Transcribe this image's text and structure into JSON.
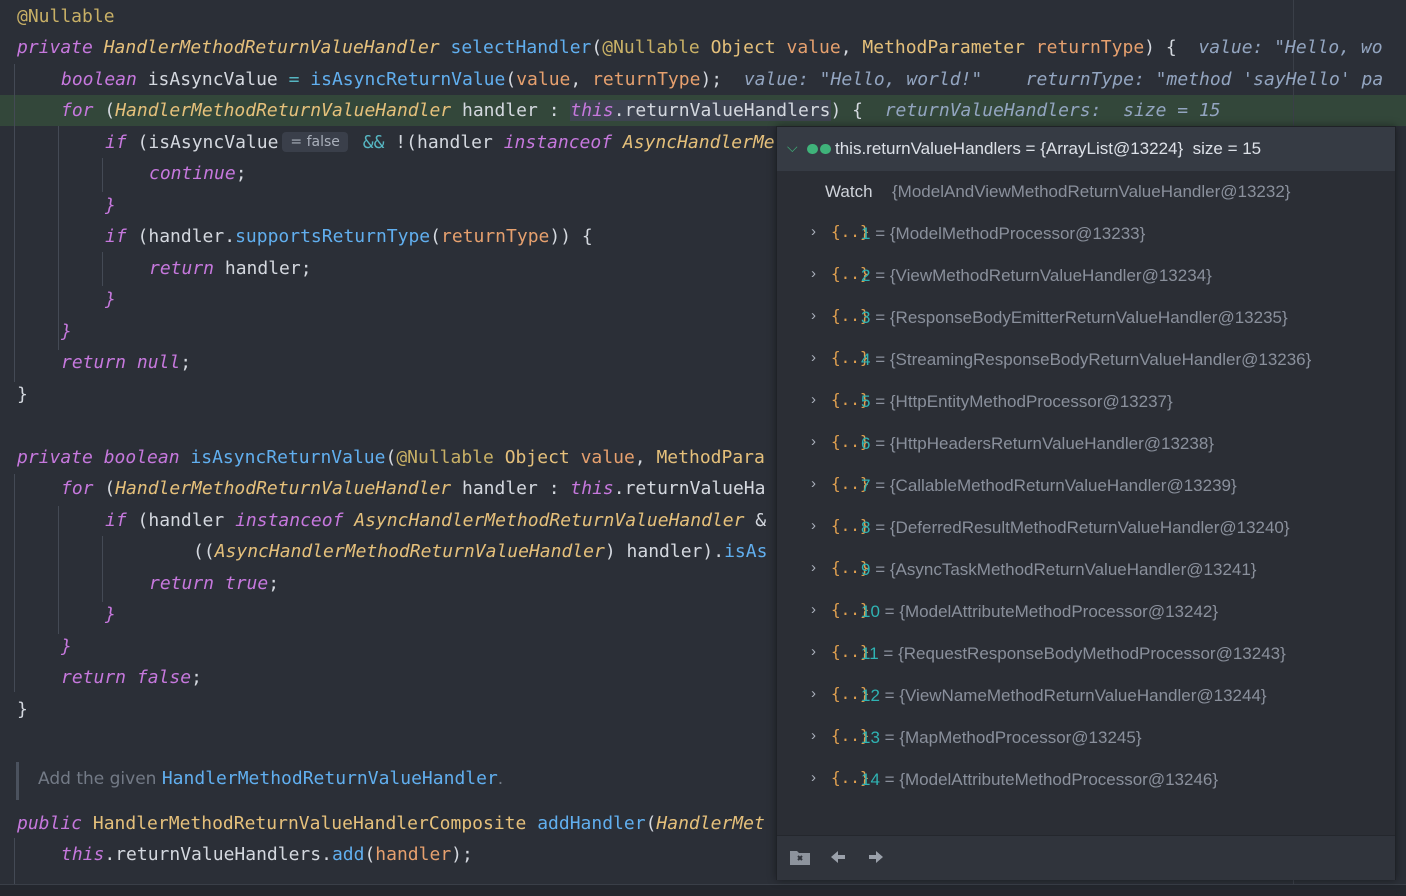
{
  "code": {
    "l1_annot": "@Nullable",
    "l2": {
      "kw": "private",
      "type": "HandlerMethodReturnValueHandler",
      "fn": "selectHandler",
      "p1": "(",
      "annot": "@Nullable",
      "t1": "Object",
      "v1": "value",
      "c": ",",
      "t2": "MethodParameter",
      "v2": "returnType",
      "tail": ") {",
      "hint": "value: \"Hello, wo"
    },
    "l3": {
      "kw": "boolean",
      "var": "isAsyncValue",
      "eq": "=",
      "fn": "isAsyncReturnValue",
      "args_open": "(",
      "a1": "value",
      "c": ",",
      "a2": "returnType",
      "close": ");",
      "hint1": "value: \"Hello, world!\"",
      "hint2": "returnType: \"method 'sayHello' pa"
    },
    "l4": {
      "kw": "for",
      "open": "(",
      "type": "HandlerMethodReturnValueHandler",
      "var": "handler",
      "colon": ":",
      "this": "this",
      "field": ".returnValueHandlers",
      "close": ") {",
      "hint": "returnValueHandlers:  size = 15"
    },
    "l5": {
      "kw": "if",
      "open": "(",
      "var": "isAsyncValue",
      "inlay": "= false",
      "and": "&&",
      "not": "!(",
      "h": "handler",
      "kw2": "instanceof",
      "type": "AsyncHandlerMe"
    },
    "l6": "continue",
    "l6_semi": ";",
    "l7": "}",
    "l8": {
      "kw": "if",
      "open": "(",
      "h": "handler",
      "dot": ".",
      "fn": "supportsReturnType",
      "p": "(",
      "arg": "returnType",
      "close": ")) {"
    },
    "l9": {
      "kw": "return",
      "val": "handler;"
    },
    "l10": "}",
    "l11": "}",
    "l12": {
      "kw": "return",
      "val": "null",
      "semi": ";"
    },
    "l13": "}",
    "l15": {
      "kw": "private",
      "kw2": "boolean",
      "fn": "isAsyncReturnValue",
      "open": "(",
      "annot": "@Nullable",
      "t1": "Object",
      "v1": "value",
      "c": ",",
      "t2": "MethodPara"
    },
    "l16": {
      "kw": "for",
      "open": "(",
      "type": "HandlerMethodReturnValueHandler",
      "var": "handler",
      "colon": ":",
      "this": "this",
      "field": ".returnValueHa"
    },
    "l17": {
      "kw": "if",
      "open": "(",
      "h": "handler",
      "kw2": "instanceof",
      "type": "AsyncHandlerMethodReturnValueHandler",
      "tail": "&"
    },
    "l18": {
      "open": "((",
      "type": "AsyncHandlerMethodReturnValueHandler",
      "close": ")",
      "h": "handler",
      "tail": ").",
      "fn": "isAs"
    },
    "l19": {
      "kw": "return",
      "val": "true",
      "semi": ";"
    },
    "l20": "}",
    "l21": "}",
    "l22": {
      "kw": "return",
      "val": "false",
      "semi": ";"
    },
    "l23": "}",
    "doc_text": "Add the given ",
    "doc_link": "HandlerMethodReturnValueHandler",
    "doc_end": ".",
    "l25": {
      "kw": "public",
      "type": "HandlerMethodReturnValueHandlerComposite",
      "fn": "addHandler",
      "open": "(",
      "t": "HandlerMet"
    },
    "l26": {
      "this": "this",
      "field": ".returnValueHandlers.",
      "fn": "add",
      "p": "(",
      "arg": "handler",
      "close": ");"
    }
  },
  "popup": {
    "header": "this.returnValueHandlers = {ArrayList@13224}  size = 15",
    "watch_label": "Watch",
    "watch_value": "{ModelAndViewMethodReturnValueHandler@13232}",
    "items": [
      {
        "idx": "1",
        "val": "{ModelMethodProcessor@13233}"
      },
      {
        "idx": "2",
        "val": "{ViewMethodReturnValueHandler@13234}"
      },
      {
        "idx": "3",
        "val": "{ResponseBodyEmitterReturnValueHandler@13235}"
      },
      {
        "idx": "4",
        "val": "{StreamingResponseBodyReturnValueHandler@13236}"
      },
      {
        "idx": "5",
        "val": "{HttpEntityMethodProcessor@13237}"
      },
      {
        "idx": "6",
        "val": "{HttpHeadersReturnValueHandler@13238}"
      },
      {
        "idx": "7",
        "val": "{CallableMethodReturnValueHandler@13239}"
      },
      {
        "idx": "8",
        "val": "{DeferredResultMethodReturnValueHandler@13240}"
      },
      {
        "idx": "9",
        "val": "{AsyncTaskMethodReturnValueHandler@13241}"
      },
      {
        "idx": "10",
        "val": "{ModelAttributeMethodProcessor@13242}"
      },
      {
        "idx": "11",
        "val": "{RequestResponseBodyMethodProcessor@13243}"
      },
      {
        "idx": "12",
        "val": "{ViewNameMethodReturnValueHandler@13244}"
      },
      {
        "idx": "13",
        "val": "{MapMethodProcessor@13245}"
      },
      {
        "idx": "14",
        "val": "{ModelAttributeMethodProcessor@13246}"
      }
    ],
    "obj_glyph": "{..}",
    "eq": "=",
    "chevron": "›",
    "footer_icons": [
      "watch-folder-icon",
      "back-arrow-icon",
      "forward-arrow-icon"
    ]
  }
}
